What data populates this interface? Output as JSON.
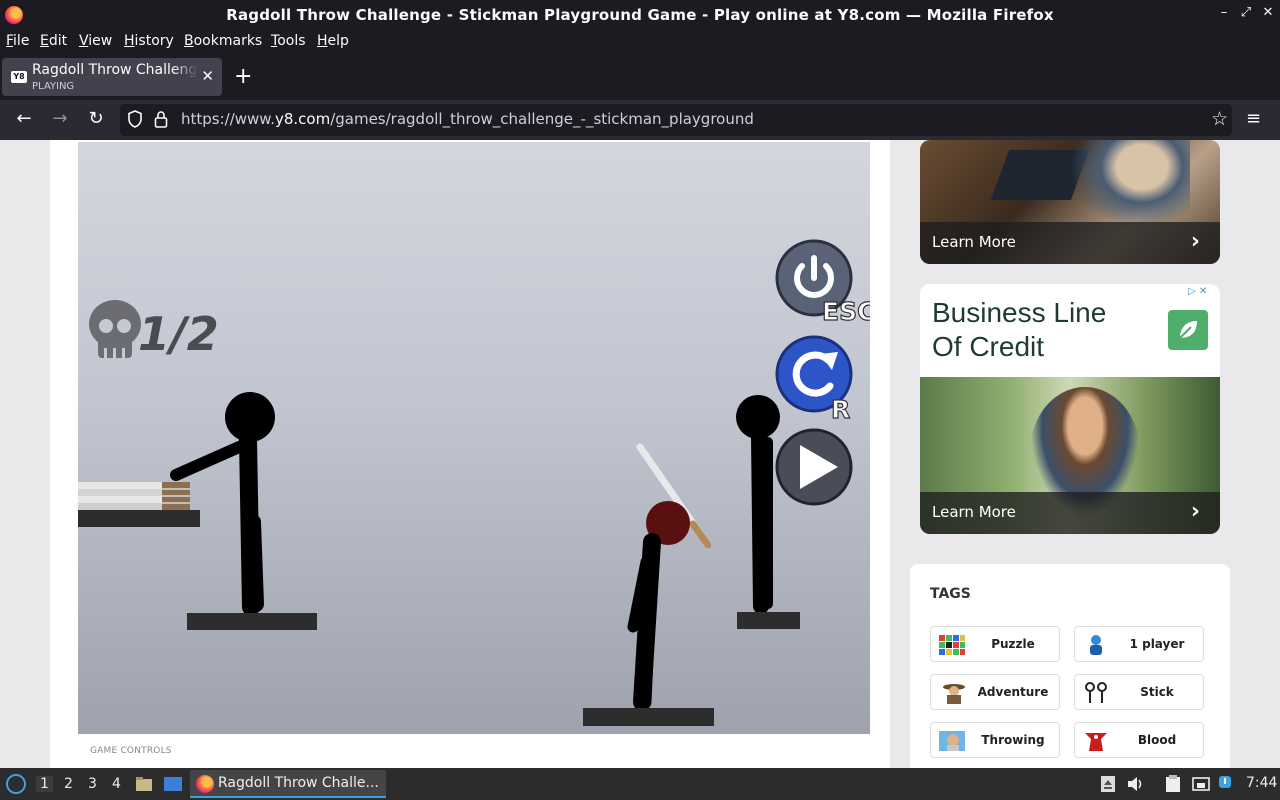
{
  "window": {
    "title": "Ragdoll Throw Challenge - Stickman Playground Game - Play online at Y8.com — Mozilla Firefox",
    "controls": [
      "–",
      "⤢",
      "✕"
    ]
  },
  "menu": [
    "File",
    "Edit",
    "View",
    "History",
    "Bookmarks",
    "Tools",
    "Help"
  ],
  "tab": {
    "title": "Ragdoll Throw Challenge - Stickman Playground Game",
    "status": "PLAYING",
    "favicon": "Y8",
    "close": "✕",
    "new_tab": "+"
  },
  "nav": {
    "back": "←",
    "forward": "→",
    "reload": "↻",
    "url_prefix": "https://www.",
    "url_host": "y8.com",
    "url_path": "/games/ragdoll_throw_challenge_-_stickman_playground",
    "star": "☆",
    "menu": "≡"
  },
  "game": {
    "kills": "1/2",
    "esc_key": "ESC",
    "restart_key": "R",
    "controls_label": "GAME CONTROLS"
  },
  "ads": {
    "ad1": {
      "cta": "Learn More",
      "chevron": "›"
    },
    "ad2": {
      "headline_1": "Business Line",
      "headline_2": "Of Credit",
      "cta": "Learn More",
      "chevron": "›",
      "adchoice": "▷ ✕"
    }
  },
  "tags": {
    "heading": "TAGS",
    "items": [
      {
        "label": "Puzzle",
        "icon": "puzzle-grid-icon"
      },
      {
        "label": "1 player",
        "icon": "player-icon"
      },
      {
        "label": "Adventure",
        "icon": "adventurer-icon"
      },
      {
        "label": "Stick",
        "icon": "stick-figures-icon"
      },
      {
        "label": "Throwing",
        "icon": "throwing-icon"
      },
      {
        "label": "Blood",
        "icon": "blood-icon"
      }
    ]
  },
  "taskbar": {
    "workspaces": [
      "1",
      "2",
      "3",
      "4"
    ],
    "task_title": "Ragdoll Throw Challe...",
    "clock": "7:44"
  },
  "colors": {
    "chrome_dark": "#1c1b22",
    "toolbar": "#2b2a33",
    "game_button_blue": "#2e55c8",
    "game_button_grey": "#4a4d57"
  }
}
